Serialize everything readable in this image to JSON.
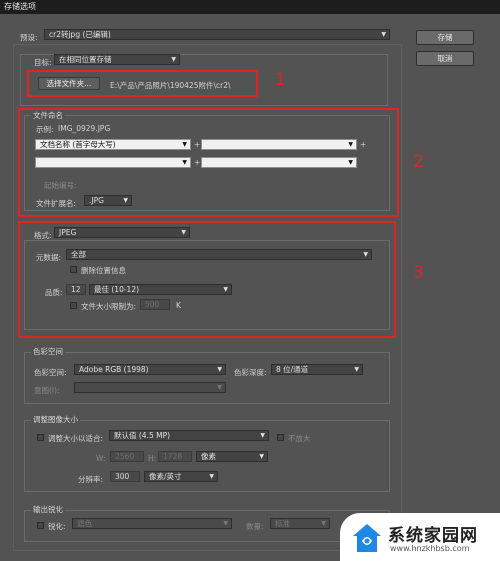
{
  "window": {
    "title": "存储选项"
  },
  "preset": {
    "label": "预设:",
    "value": "cr2转jpg (已编辑)"
  },
  "buttons": {
    "save": "存储",
    "cancel": "取消"
  },
  "destination": {
    "title": "目标",
    "label": "目标:",
    "location": "在相同位置存储",
    "choose_folder": "选择文件夹...",
    "path": "E:\\产品\\产品照片\\190425附件\\cr2\\"
  },
  "file_naming": {
    "title": "文件命名",
    "example_label": "示例:",
    "example_value": "IMG_0929.JPG",
    "field1": "文档名称 (首字母大写)",
    "field2": "",
    "field3": "",
    "field4": "",
    "plus": "+",
    "start_number_label": "起始编号:",
    "ext_label": "文件扩展名:",
    "ext_value": ".JPG"
  },
  "format": {
    "label": "格式:",
    "value": "JPEG",
    "metadata_label": "元数据:",
    "metadata_value": "全部",
    "remove_location": "删除位置信息",
    "quality_label": "品质:",
    "quality_number": "12",
    "quality_value": "最佳 (10-12)",
    "limit_size": "文件大小限制为:",
    "limit_value": "500",
    "limit_unit": "K"
  },
  "color_space": {
    "title": "色彩空间",
    "space_label": "色彩空间:",
    "space_value": "Adobe RGB (1998)",
    "depth_label": "色彩深度:",
    "depth_value": "8 位/通道",
    "intent_label": "意图(I):"
  },
  "resize": {
    "title": "调整图像大小",
    "fit_label": "调整大小以适合:",
    "fit_value": "默认值 (4.5 MP)",
    "no_enlarge": "不放大",
    "w_label": "W:",
    "w_value": "2560",
    "h_label": "H:",
    "h_value": "1728",
    "px_unit": "像素",
    "resolution_label": "分辨率:",
    "resolution_value": "300",
    "resolution_unit": "像素/英寸"
  },
  "sharpen": {
    "title": "输出锐化",
    "sharpen_label": "锐化:",
    "sharpen_value": "滤色",
    "amount_label": "数量:",
    "amount_value": "标准"
  },
  "annotations": {
    "n1": "1",
    "n2": "2",
    "n3": "3"
  },
  "watermark": {
    "text": "系统家园网",
    "url": "www.hnzkhbsb.com"
  }
}
